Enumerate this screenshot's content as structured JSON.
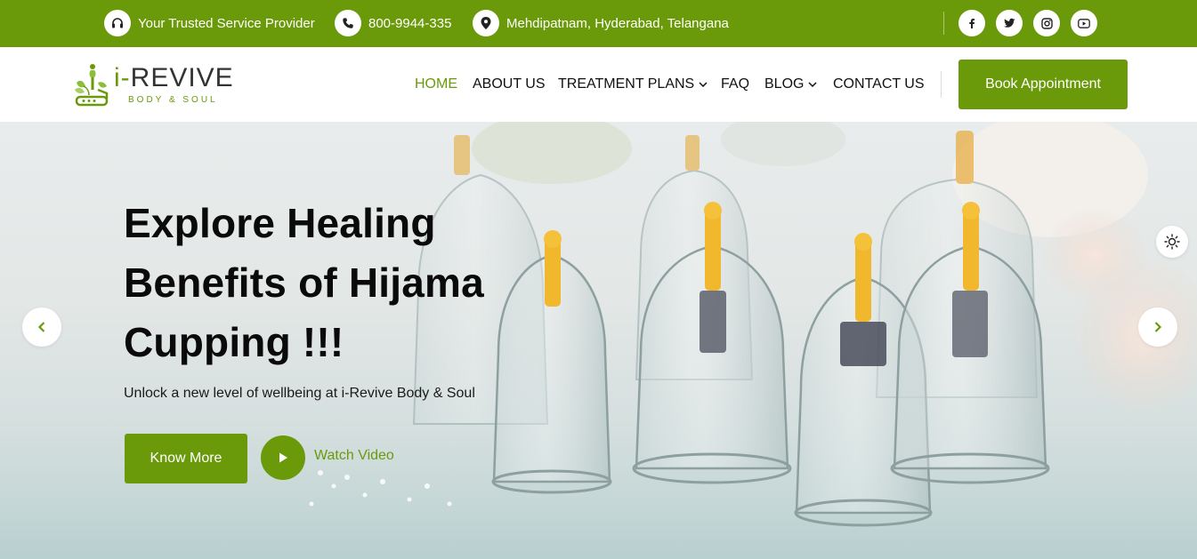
{
  "topbar": {
    "tagline": "Your Trusted Service Provider",
    "phone": "800-9944-335",
    "address": "Mehdipatnam, Hyderabad, Telangana",
    "social": [
      "facebook-icon",
      "twitter-icon",
      "instagram-icon",
      "youtube-icon"
    ]
  },
  "brand": {
    "name_prefix": "i-",
    "name_main": "REVIVE",
    "subtitle": "BODY & SOUL",
    "accent_color": "#6a9a0a"
  },
  "nav": {
    "home": "HOME",
    "about": "ABOUT US",
    "treatment": "TREATMENT PLANS",
    "faq": "FAQ",
    "blog": "BLOG",
    "contact": "CONTACT US",
    "cta": "Book Appointment"
  },
  "hero": {
    "title_line1": "Explore Healing",
    "title_line2": "Benefits of Hijama",
    "title_line3": "Cupping !!!",
    "subtitle": "Unlock a new level of wellbeing at i-Revive Body & Soul",
    "primary_button": "Know More",
    "video_link": "Watch Video"
  }
}
